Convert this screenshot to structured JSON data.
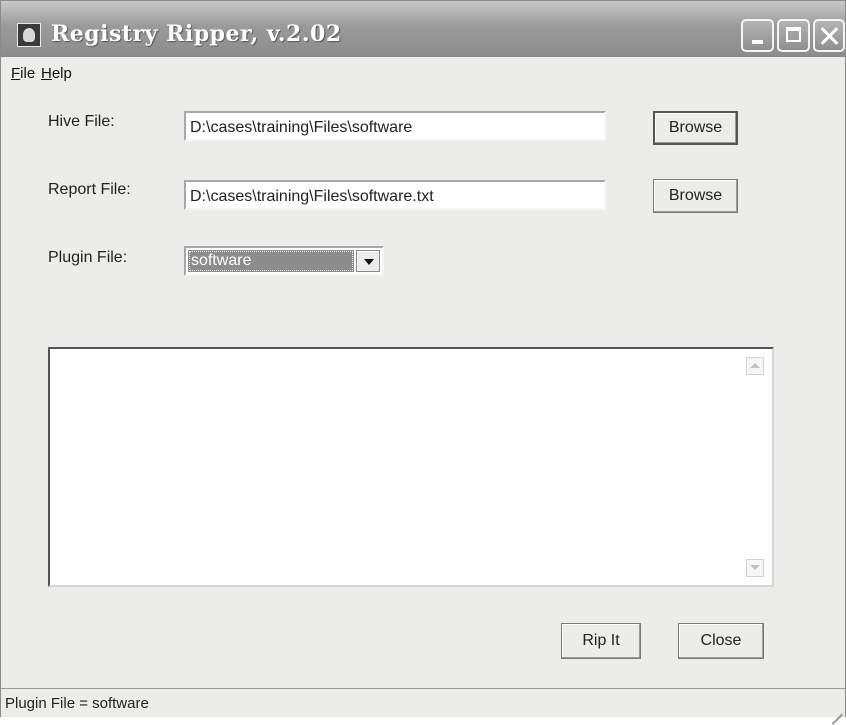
{
  "window": {
    "title": "Registry Ripper, v.2.02"
  },
  "menu": {
    "file": {
      "mnemonic": "F",
      "rest": "ile"
    },
    "help": {
      "mnemonic": "H",
      "rest": "elp"
    }
  },
  "form": {
    "hive_label": "Hive File:",
    "hive_value": "D:\\cases\\training\\Files\\software",
    "report_label": "Report File:",
    "report_value": "D:\\cases\\training\\Files\\software.txt",
    "plugin_label": "Plugin File:",
    "plugin_value": "software",
    "browse_label": "Browse"
  },
  "actions": {
    "rip_label": "Rip It",
    "close_label": "Close"
  },
  "status": {
    "text": "Plugin File = software"
  }
}
